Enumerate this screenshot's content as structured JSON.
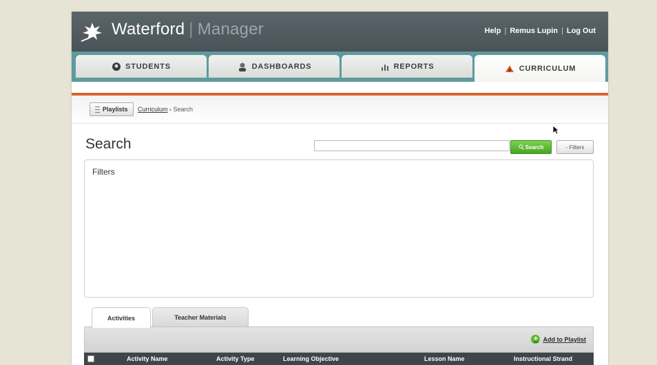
{
  "header": {
    "brand_name": "Waterford",
    "brand_product": "Manager",
    "links": [
      "Help",
      "Remus Lupin",
      "Log Out"
    ]
  },
  "tabs": [
    {
      "label": "STUDENTS",
      "icon": "student-icon"
    },
    {
      "label": "DASHBOARDS",
      "icon": "dashboard-icon"
    },
    {
      "label": "REPORTS",
      "icon": "bar-chart-icon"
    },
    {
      "label": "CURRICULUM",
      "icon": "curriculum-icon",
      "active": true
    }
  ],
  "breadcrumb": {
    "playlists_label": "Playlists",
    "path": [
      "Curriculum",
      "Search"
    ],
    "separator": "›"
  },
  "search": {
    "title": "Search",
    "input_value": "",
    "button_label": "Search",
    "filters_button_label": "- Filters"
  },
  "filters_panel": {
    "title": "Filters"
  },
  "result_tabs": [
    "Activities",
    "Teacher Materials"
  ],
  "results": {
    "add_to_playlist": "Add to Playlist",
    "columns": [
      "Activity Name",
      "Activity Type",
      "Learning Objective",
      "Lesson Name",
      "Instructional Strand"
    ]
  },
  "colors": {
    "header_bg": "#525c61",
    "tab_band": "#5f9a9e",
    "accent_orange": "#d9642c",
    "search_green": "#4fb02a"
  }
}
